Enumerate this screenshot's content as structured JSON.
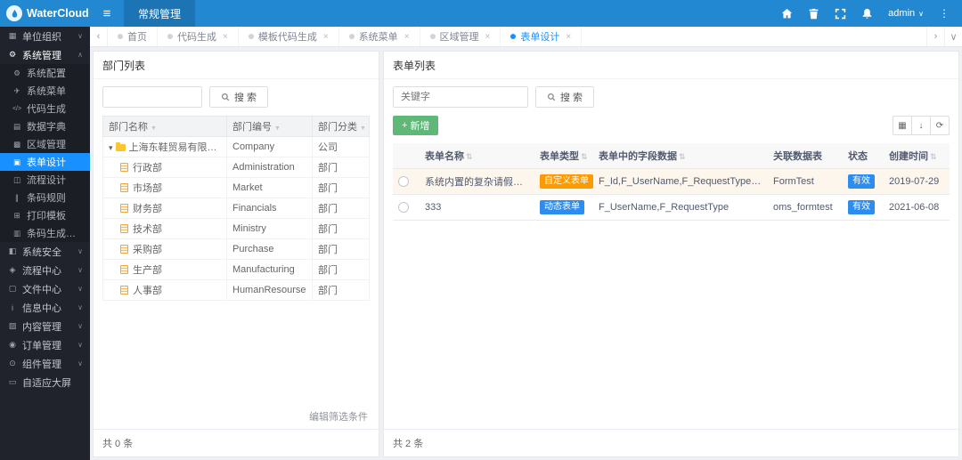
{
  "colors": {
    "topbar": "#2288d1",
    "accent": "#1890ff",
    "green": "#5fb878",
    "orange": "#ff9900",
    "sidebar_bg": "#20232b"
  },
  "icons": {
    "hamburger": "≡",
    "admin_caret": "∨",
    "more": "⋮",
    "prev": "‹",
    "next": "›",
    "collapse": "∨",
    "close": "×",
    "caret_down": "▾",
    "funnel": "▼",
    "sort": "⇅",
    "plus": "+",
    "grid": "▦",
    "download": "↓",
    "refresh": "⟳"
  },
  "topbar": {
    "brand": "WaterCloud",
    "module_tab": "常规管理",
    "admin": "admin"
  },
  "sidebar": {
    "items": [
      {
        "label": "单位组织",
        "glyph": "▦",
        "chevron": "∨"
      },
      {
        "label": "系统管理",
        "glyph": "⚙",
        "chevron": "∧"
      },
      {
        "label": "系统配置",
        "glyph": "⚙",
        "chevron": ""
      },
      {
        "label": "系统菜单",
        "glyph": "✈",
        "chevron": ""
      },
      {
        "label": "代码生成",
        "glyph": "</>",
        "chevron": ""
      },
      {
        "label": "数据字典",
        "glyph": "▤",
        "chevron": ""
      },
      {
        "label": "区域管理",
        "glyph": "▩",
        "chevron": ""
      },
      {
        "label": "表单设计",
        "glyph": "▣",
        "chevron": ""
      },
      {
        "label": "流程设计",
        "glyph": "◫",
        "chevron": ""
      },
      {
        "label": "条码规则",
        "glyph": "∥",
        "chevron": ""
      },
      {
        "label": "打印模板",
        "glyph": "⊞",
        "chevron": ""
      },
      {
        "label": "条码生成记录",
        "glyph": "▥",
        "chevron": ""
      },
      {
        "label": "系统安全",
        "glyph": "◧",
        "chevron": "∨"
      },
      {
        "label": "流程中心",
        "glyph": "◈",
        "chevron": "∨"
      },
      {
        "label": "文件中心",
        "glyph": "▢",
        "chevron": "∨"
      },
      {
        "label": "信息中心",
        "glyph": "i",
        "chevron": "∨"
      },
      {
        "label": "内容管理",
        "glyph": "▨",
        "chevron": "∨"
      },
      {
        "label": "订单管理",
        "glyph": "◉",
        "chevron": "∨"
      },
      {
        "label": "组件管理",
        "glyph": "⊙",
        "chevron": "∨"
      },
      {
        "label": "自适应大屏",
        "glyph": "▭",
        "chevron": ""
      }
    ]
  },
  "tabs": {
    "items": [
      {
        "label": "首页"
      },
      {
        "label": "代码生成"
      },
      {
        "label": "模板代码生成"
      },
      {
        "label": "系统菜单"
      },
      {
        "label": "区域管理"
      },
      {
        "label": "表单设计"
      }
    ]
  },
  "dept_panel": {
    "title": "部门列表",
    "search_label": "搜 索",
    "columns": [
      "部门名称",
      "部门编号",
      "部门分类"
    ],
    "rows": [
      {
        "name": "上海东鞋贸易有限公司",
        "code": "Company",
        "type": "公司"
      },
      {
        "name": "行政部",
        "code": "Administration",
        "type": "部门"
      },
      {
        "name": "市场部",
        "code": "Market",
        "type": "部门"
      },
      {
        "name": "财务部",
        "code": "Financials",
        "type": "部门"
      },
      {
        "name": "技术部",
        "code": "Ministry",
        "type": "部门"
      },
      {
        "name": "采购部",
        "code": "Purchase",
        "type": "部门"
      },
      {
        "name": "生产部",
        "code": "Manufacturing",
        "type": "部门"
      },
      {
        "name": "人事部",
        "code": "HumanResourse",
        "type": "部门"
      }
    ],
    "edit_filter": "编辑筛选条件",
    "footer": "共 0 条"
  },
  "form_panel": {
    "title": "表单列表",
    "keyword_placeholder": "关键字",
    "search_label": "搜 索",
    "add_label": "新增",
    "columns": [
      "表单名称",
      "表单类型",
      "表单中的字段数据",
      "关联数据表",
      "状态",
      "创建时间"
    ],
    "rows": [
      {
        "name": "系统内置的复杂请假条表单",
        "type": "自定义表单",
        "fields": "F_Id,F_UserName,F_RequestType,F_StartTime,F_E...",
        "table": "FormTest",
        "status": "有效",
        "created": "2019-07-29"
      },
      {
        "name": "333",
        "type": "动态表单",
        "fields": "F_UserName,F_RequestType",
        "table": "oms_formtest",
        "status": "有效",
        "created": "2021-06-08"
      }
    ],
    "footer": "共 2 条"
  }
}
